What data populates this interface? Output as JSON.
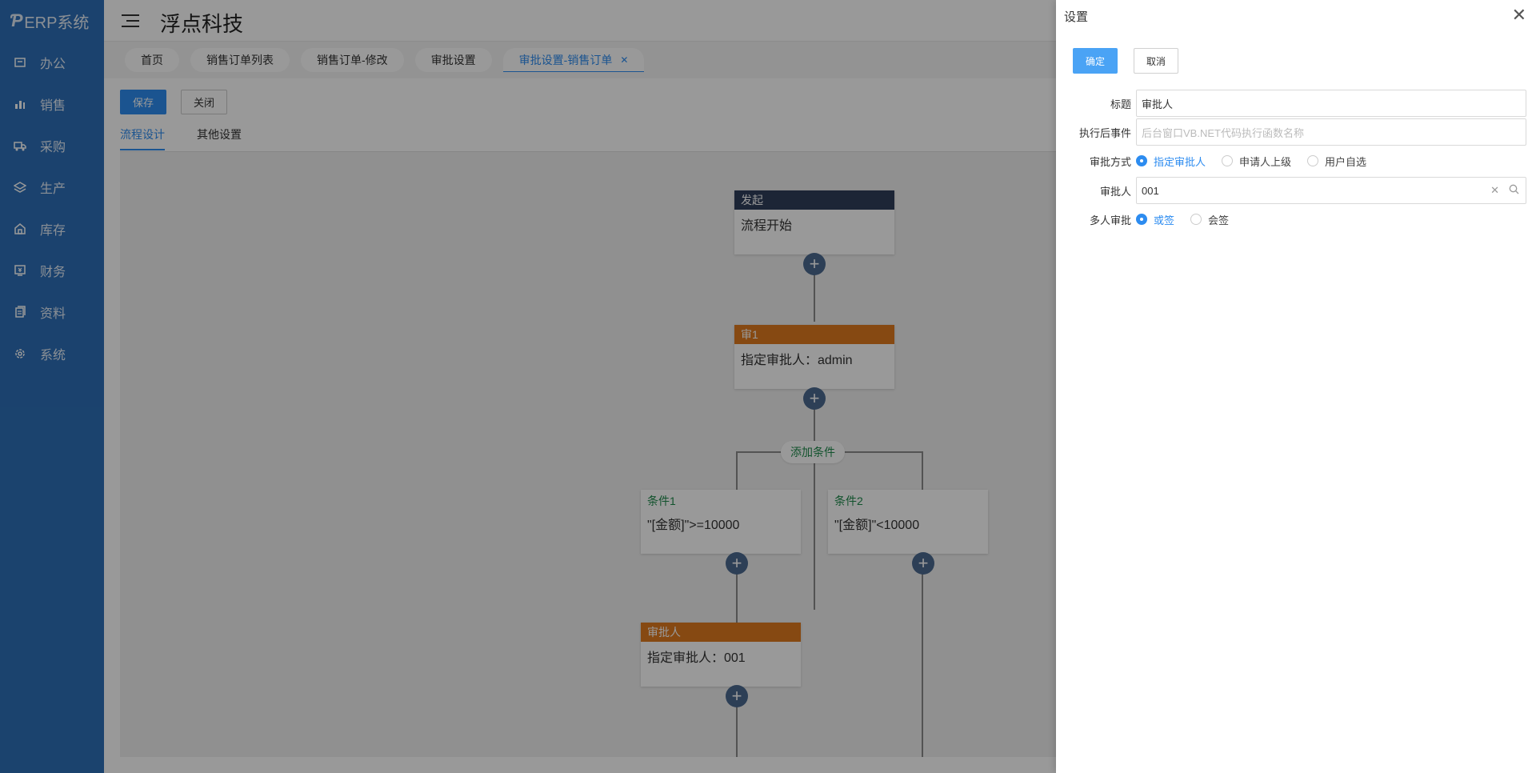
{
  "app": {
    "logo_text": "ERP系统",
    "company": "浮点科技"
  },
  "sidebar": {
    "items": [
      {
        "label": "办公",
        "icon": "office-icon"
      },
      {
        "label": "销售",
        "icon": "bar-chart-icon"
      },
      {
        "label": "采购",
        "icon": "truck-icon"
      },
      {
        "label": "生产",
        "icon": "layers-icon"
      },
      {
        "label": "库存",
        "icon": "warehouse-icon"
      },
      {
        "label": "财务",
        "icon": "finance-icon"
      },
      {
        "label": "资料",
        "icon": "documents-icon"
      },
      {
        "label": "系统",
        "icon": "system-gear-icon"
      }
    ]
  },
  "tabs": [
    {
      "label": "首页"
    },
    {
      "label": "销售订单列表"
    },
    {
      "label": "销售订单-修改"
    },
    {
      "label": "审批设置"
    },
    {
      "label": "审批设置-销售订单",
      "active": true
    }
  ],
  "toolbar": {
    "save_label": "保存",
    "close_label": "关闭"
  },
  "subtabs": {
    "flow_design": "流程设计",
    "other_settings": "其他设置"
  },
  "flow": {
    "start": {
      "header": "发起",
      "body": "流程开始"
    },
    "approve1": {
      "header": "审1",
      "body": "指定审批人：admin"
    },
    "add_condition": "添加条件",
    "cond1": {
      "title": "条件1",
      "body": "\"[金额]\">=10000"
    },
    "cond2": {
      "title": "条件2",
      "body": "\"[金额]\"<10000"
    },
    "approver": {
      "header": "审批人",
      "body": "指定审批人：001"
    },
    "add_symbol": "+"
  },
  "drawer": {
    "title": "设置",
    "close_symbol": "✕",
    "ok_label": "确定",
    "cancel_label": "取消",
    "title_label": "标题",
    "title_value": "审批人",
    "event_label": "执行后事件",
    "event_placeholder": "后台窗口VB.NET代码执行函数名称",
    "method_label": "审批方式",
    "method_options": [
      "指定审批人",
      "申请人上级",
      "用户自选"
    ],
    "method_selected": "指定审批人",
    "approver_label": "审批人",
    "approver_value": "001",
    "multi_label": "多人审批",
    "multi_options": [
      "或签",
      "会签"
    ],
    "multi_selected": "或签"
  },
  "colors": {
    "sidebar": "#2d6fb8",
    "primary": "#2d8cf0",
    "node_dark": "#2f3e5a",
    "node_orange": "#e07a1f",
    "condition_green": "#1f8a4c"
  }
}
